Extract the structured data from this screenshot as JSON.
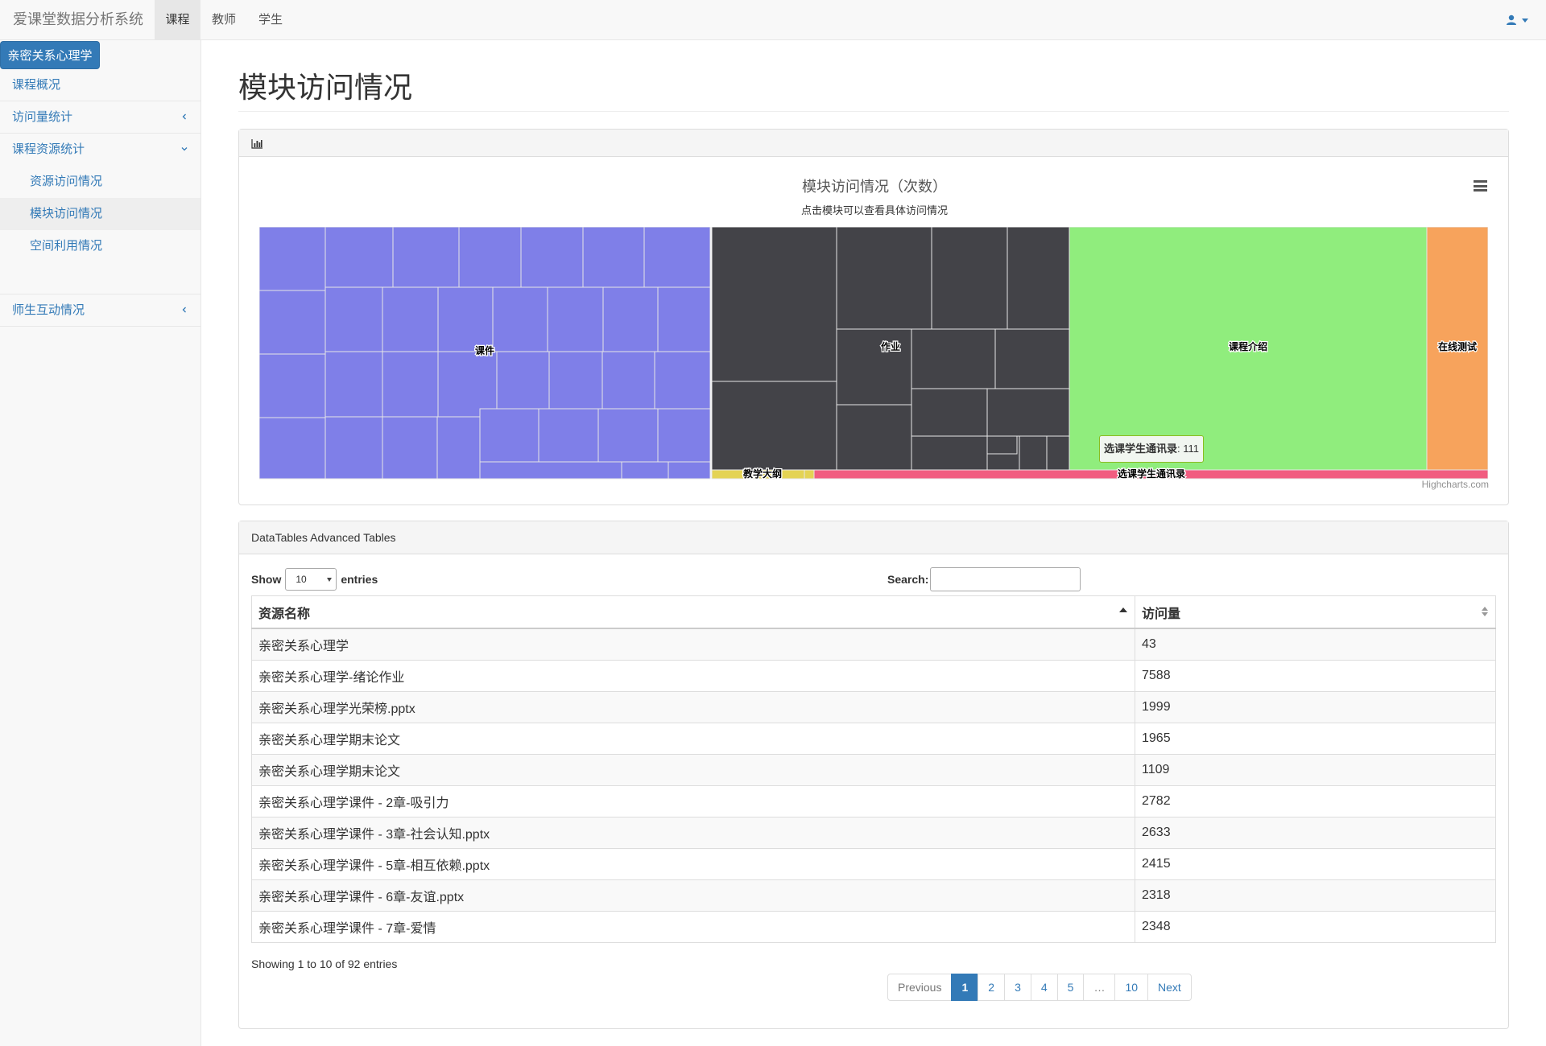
{
  "navbar": {
    "brand": "爱课堂数据分析系统",
    "links": [
      "课程",
      "教师",
      "学生"
    ]
  },
  "sidebar": {
    "course": "亲密关系心理学",
    "items": [
      {
        "label": "课程概况"
      },
      {
        "label": "访问量统计"
      },
      {
        "label": "课程资源统计"
      },
      {
        "label": "资源访问情况"
      },
      {
        "label": "模块访问情况"
      },
      {
        "label": "空间利用情况"
      },
      {
        "label": "师生互动情况"
      }
    ]
  },
  "page_title": "模块访问情况",
  "chart_panel": {
    "credit": "Highcharts.com",
    "tooltip": {
      "label": "选课学生通讯录",
      "value": "111"
    }
  },
  "chart_data": {
    "type": "treemap",
    "title": "模块访问情况（次数）",
    "subtitle": "点击模块可以查看具体访问情况",
    "groups": [
      {
        "name": "课件",
        "color": "#7f7fe8"
      },
      {
        "name": "作业",
        "color": "#434348"
      },
      {
        "name": "课程介绍",
        "color": "#90ed7d"
      },
      {
        "name": "在线测试",
        "color": "#f7a35c"
      },
      {
        "name": "教学大纲",
        "color": "#e4d354"
      },
      {
        "name": "选课学生通讯录",
        "color": "#f15c80",
        "value": 111
      }
    ]
  },
  "table_panel": {
    "heading": "DataTables Advanced Tables",
    "show": "Show",
    "entries": "entries",
    "length_value": "10",
    "search_label": "Search:",
    "columns": [
      "资源名称",
      "访问量"
    ],
    "rows": [
      [
        "亲密关系心理学",
        "43"
      ],
      [
        "亲密关系心理学-绪论作业",
        "7588"
      ],
      [
        "亲密关系心理学光荣榜.pptx",
        "1999"
      ],
      [
        "亲密关系心理学期末论文",
        "1965"
      ],
      [
        "亲密关系心理学期末论文",
        "1109"
      ],
      [
        "亲密关系心理学课件 - 2章-吸引力",
        "2782"
      ],
      [
        "亲密关系心理学课件 - 3章-社会认知.pptx",
        "2633"
      ],
      [
        "亲密关系心理学课件 - 5章-相互依赖.pptx",
        "2415"
      ],
      [
        "亲密关系心理学课件 - 6章-友谊.pptx",
        "2318"
      ],
      [
        "亲密关系心理学课件 - 7章-爱情",
        "2348"
      ]
    ],
    "info": "Showing 1 to 10 of 92 entries",
    "pagination": [
      "Previous",
      "1",
      "2",
      "3",
      "4",
      "5",
      "…",
      "10",
      "Next"
    ]
  }
}
